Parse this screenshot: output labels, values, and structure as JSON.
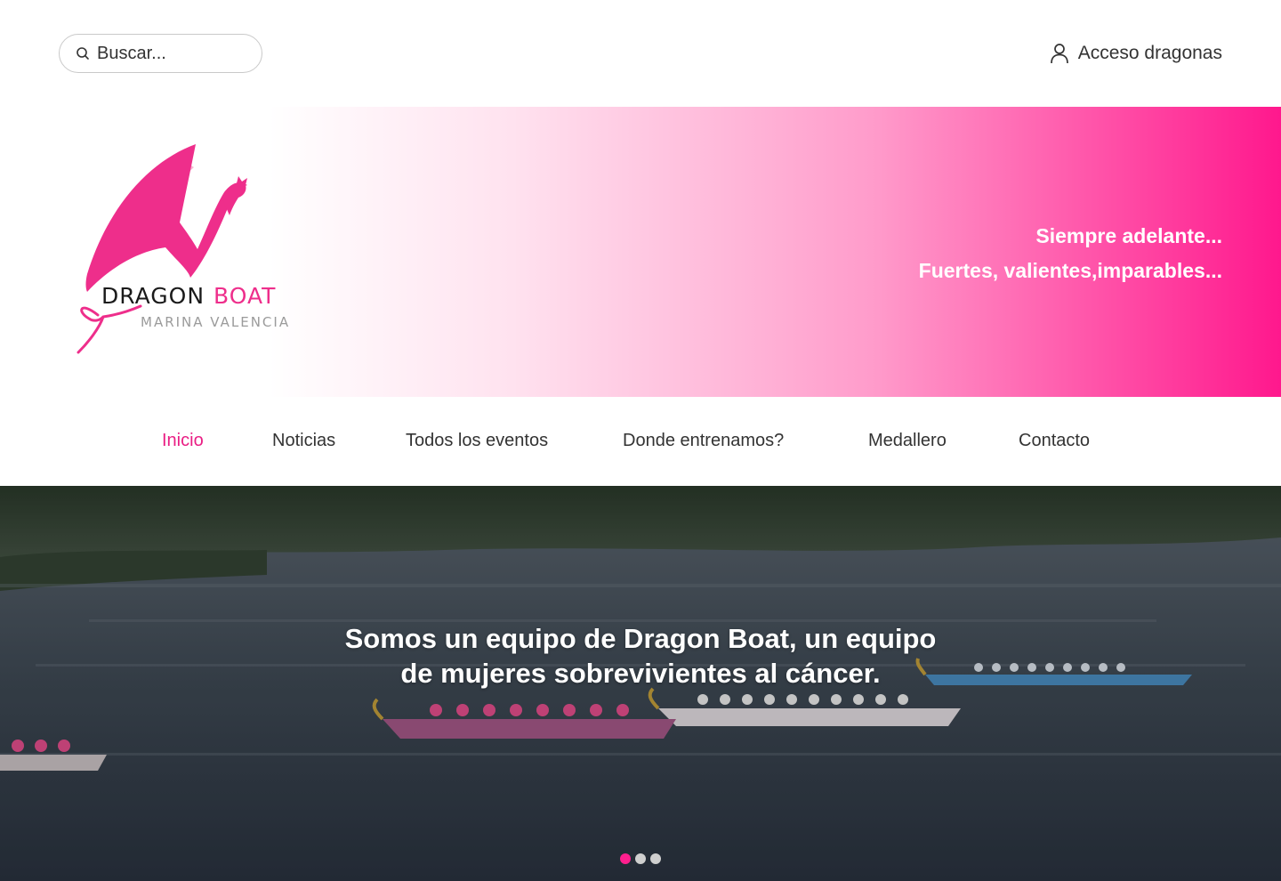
{
  "search": {
    "placeholder": "Buscar..."
  },
  "account": {
    "label": "Acceso dragonas"
  },
  "brand": {
    "title_word1": "DRAGON",
    "title_word2": "BOAT",
    "subtitle": "MARINA VALENCIA",
    "accent_color": "#e91e84"
  },
  "slogan": {
    "line1": "Siempre adelante...",
    "line2": "Fuertes, valientes,imparables..."
  },
  "nav": {
    "items": [
      {
        "label": "Inicio",
        "active": true
      },
      {
        "label": "Noticias"
      },
      {
        "label": "Todos los eventos"
      },
      {
        "label": "Donde entrenamos?"
      },
      {
        "label": "Medallero"
      },
      {
        "label": "Contacto"
      }
    ]
  },
  "hero": {
    "line1": "Somos un equipo de Dragon Boat, un equipo",
    "line2": "de mujeres sobrevivientes al cáncer.",
    "slide_count": 3,
    "active_slide": 1
  },
  "icons": {
    "search": "search-icon",
    "account": "user-icon"
  }
}
